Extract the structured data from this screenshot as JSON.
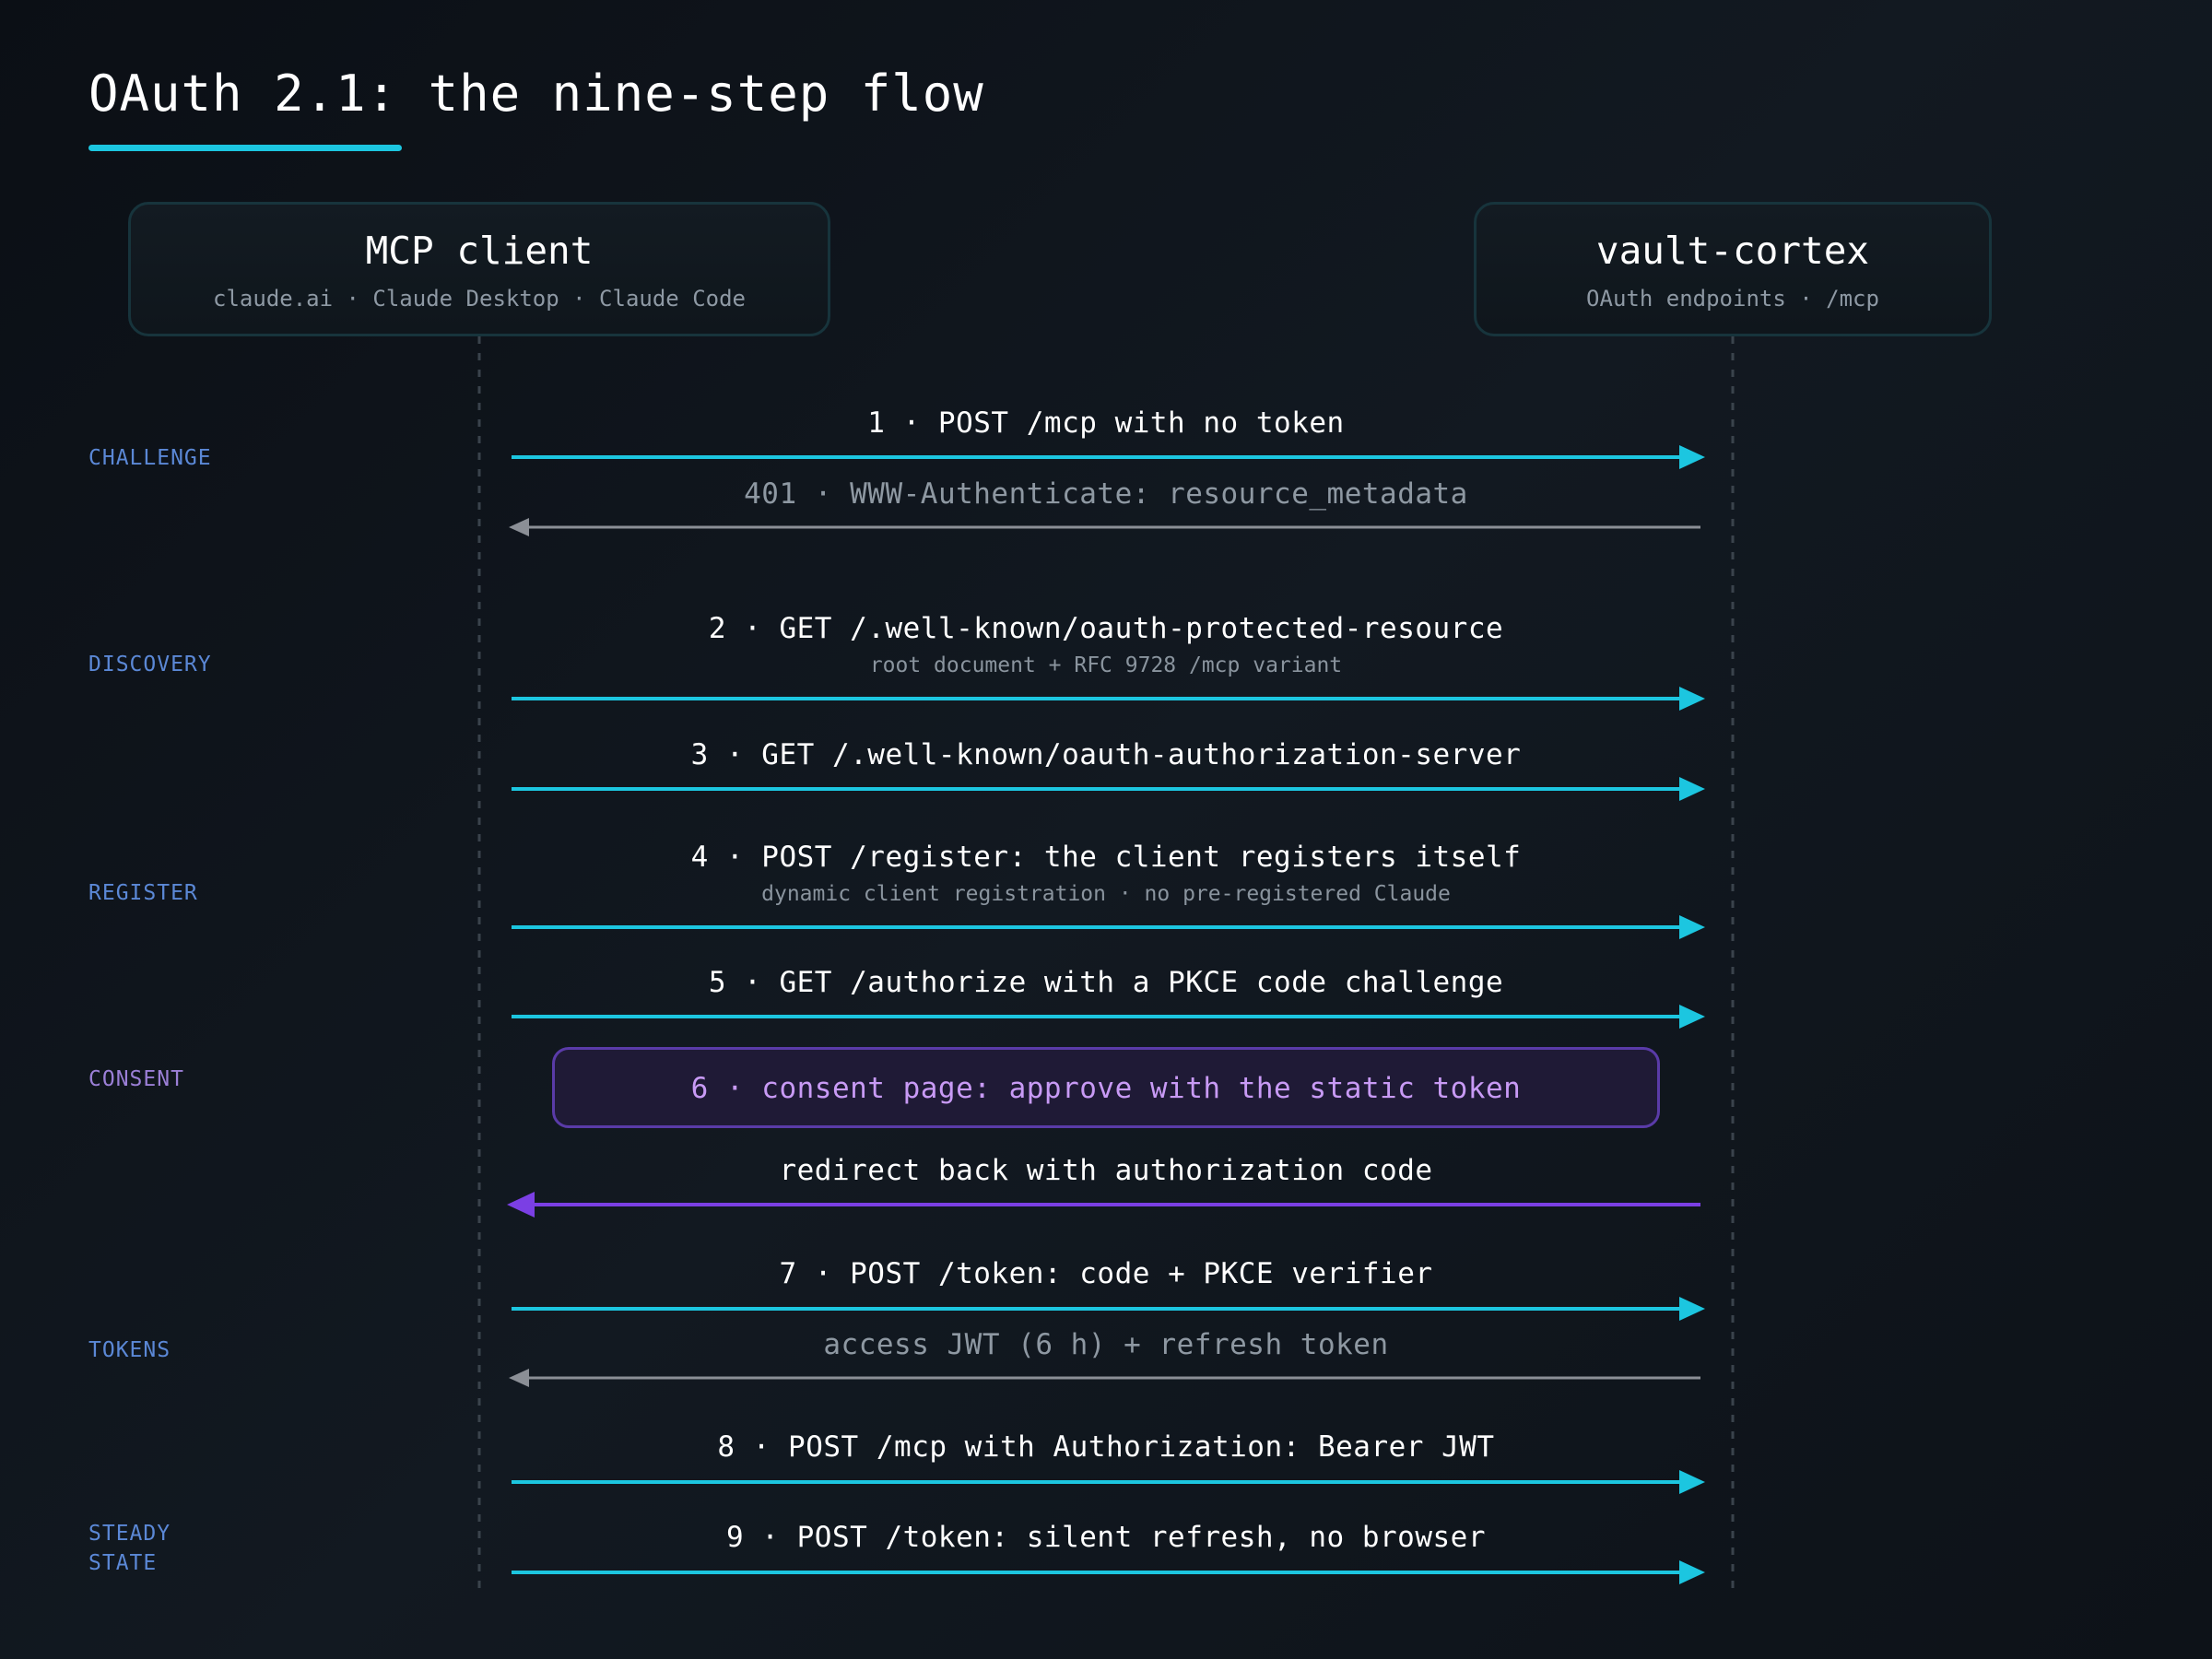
{
  "title": "OAuth 2.1: the nine-step flow",
  "colors": {
    "accent_cyan": "#1cc6e0",
    "response_gray": "#8b8f96",
    "consent_purple": "#7b3fe4",
    "phase_blue": "#5b88d6",
    "phase_purple": "#9b7fd6"
  },
  "actors": {
    "client": {
      "name": "MCP client",
      "subtitle": "claude.ai · Claude Desktop · Claude Code"
    },
    "server": {
      "name": "vault-cortex",
      "subtitle": "OAuth endpoints · /mcp"
    }
  },
  "phases": {
    "challenge": "CHALLENGE",
    "discovery": "DISCOVERY",
    "register": "REGISTER",
    "consent": "CONSENT",
    "tokens": "TOKENS",
    "steady_state": [
      "STEADY",
      "STATE"
    ]
  },
  "messages": [
    {
      "label": "1 · POST /mcp with no token",
      "direction": "client-to-server",
      "style": "request"
    },
    {
      "label": "401 · WWW-Authenticate: resource_metadata",
      "direction": "server-to-client",
      "style": "response"
    },
    {
      "label": "2 · GET /.well-known/oauth-protected-resource",
      "sublabel": "root document + RFC 9728 /mcp variant",
      "direction": "client-to-server",
      "style": "request"
    },
    {
      "label": "3 · GET /.well-known/oauth-authorization-server",
      "direction": "client-to-server",
      "style": "request"
    },
    {
      "label": "4 · POST /register: the client registers itself",
      "sublabel": "dynamic client registration · no pre-registered Claude",
      "direction": "client-to-server",
      "style": "request"
    },
    {
      "label": "5 · GET /authorize with a PKCE code challenge",
      "direction": "client-to-server",
      "style": "request"
    },
    {
      "label": "redirect back with authorization code",
      "direction": "server-to-client",
      "style": "redirect"
    },
    {
      "label": "7 · POST /token: code + PKCE verifier",
      "direction": "client-to-server",
      "style": "request"
    },
    {
      "label": "access JWT (6 h) + refresh token",
      "direction": "server-to-client",
      "style": "response"
    },
    {
      "label": "8 · POST /mcp with Authorization: Bearer JWT",
      "direction": "client-to-server",
      "style": "request"
    },
    {
      "label": "9 · POST /token: silent refresh, no browser",
      "direction": "client-to-server",
      "style": "request"
    }
  ],
  "consent_step": {
    "label": "6 · consent page: approve with the static token"
  }
}
